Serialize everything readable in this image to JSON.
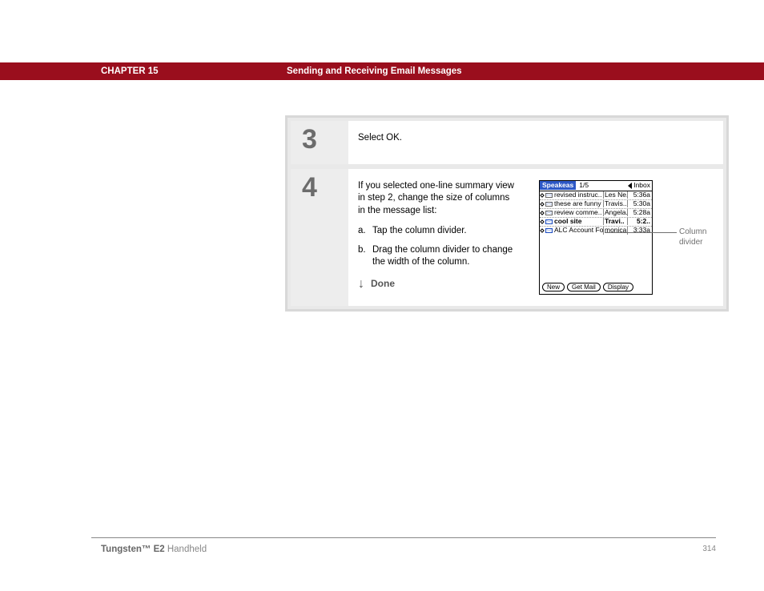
{
  "header": {
    "chapter": "CHAPTER 15",
    "title": "Sending and Receiving Email Messages"
  },
  "steps": {
    "s3": {
      "num": "3",
      "text": "Select OK."
    },
    "s4": {
      "num": "4",
      "intro": "If you selected one-line summary view in step 2, change the size of columns in the message list:",
      "a_lbl": "a.",
      "a_txt": "Tap the column divider.",
      "b_lbl": "b.",
      "b_txt": "Drag the column divider to change the width of the column.",
      "done": "Done"
    }
  },
  "pda": {
    "title": "Speakeas",
    "page": "1/5",
    "mailbox": "Inbox",
    "rows": [
      {
        "subj": "revised instruc..",
        "from": "Les Ne..",
        "time": "5:36a",
        "bold": false,
        "opened": true
      },
      {
        "subj": "these are funny",
        "from": "Travis..",
        "time": "5:30a",
        "bold": false,
        "opened": true
      },
      {
        "subj": "review comme..",
        "from": "Angela..",
        "time": "5:28a",
        "bold": false,
        "opened": true
      },
      {
        "subj": "cool site",
        "from": "Travi..",
        "time": "5:2..",
        "bold": true,
        "opened": false
      },
      {
        "subj": "ALC Account Fo..",
        "from": "monica..",
        "time": "3:33a",
        "bold": false,
        "opened": false
      }
    ],
    "btn_new": "New",
    "btn_get": "Get Mail",
    "btn_disp": "Display"
  },
  "annotation": {
    "col_div": "Column divider"
  },
  "footer": {
    "brand": "Tungsten™ E2",
    "product": " Handheld",
    "page": "314"
  }
}
